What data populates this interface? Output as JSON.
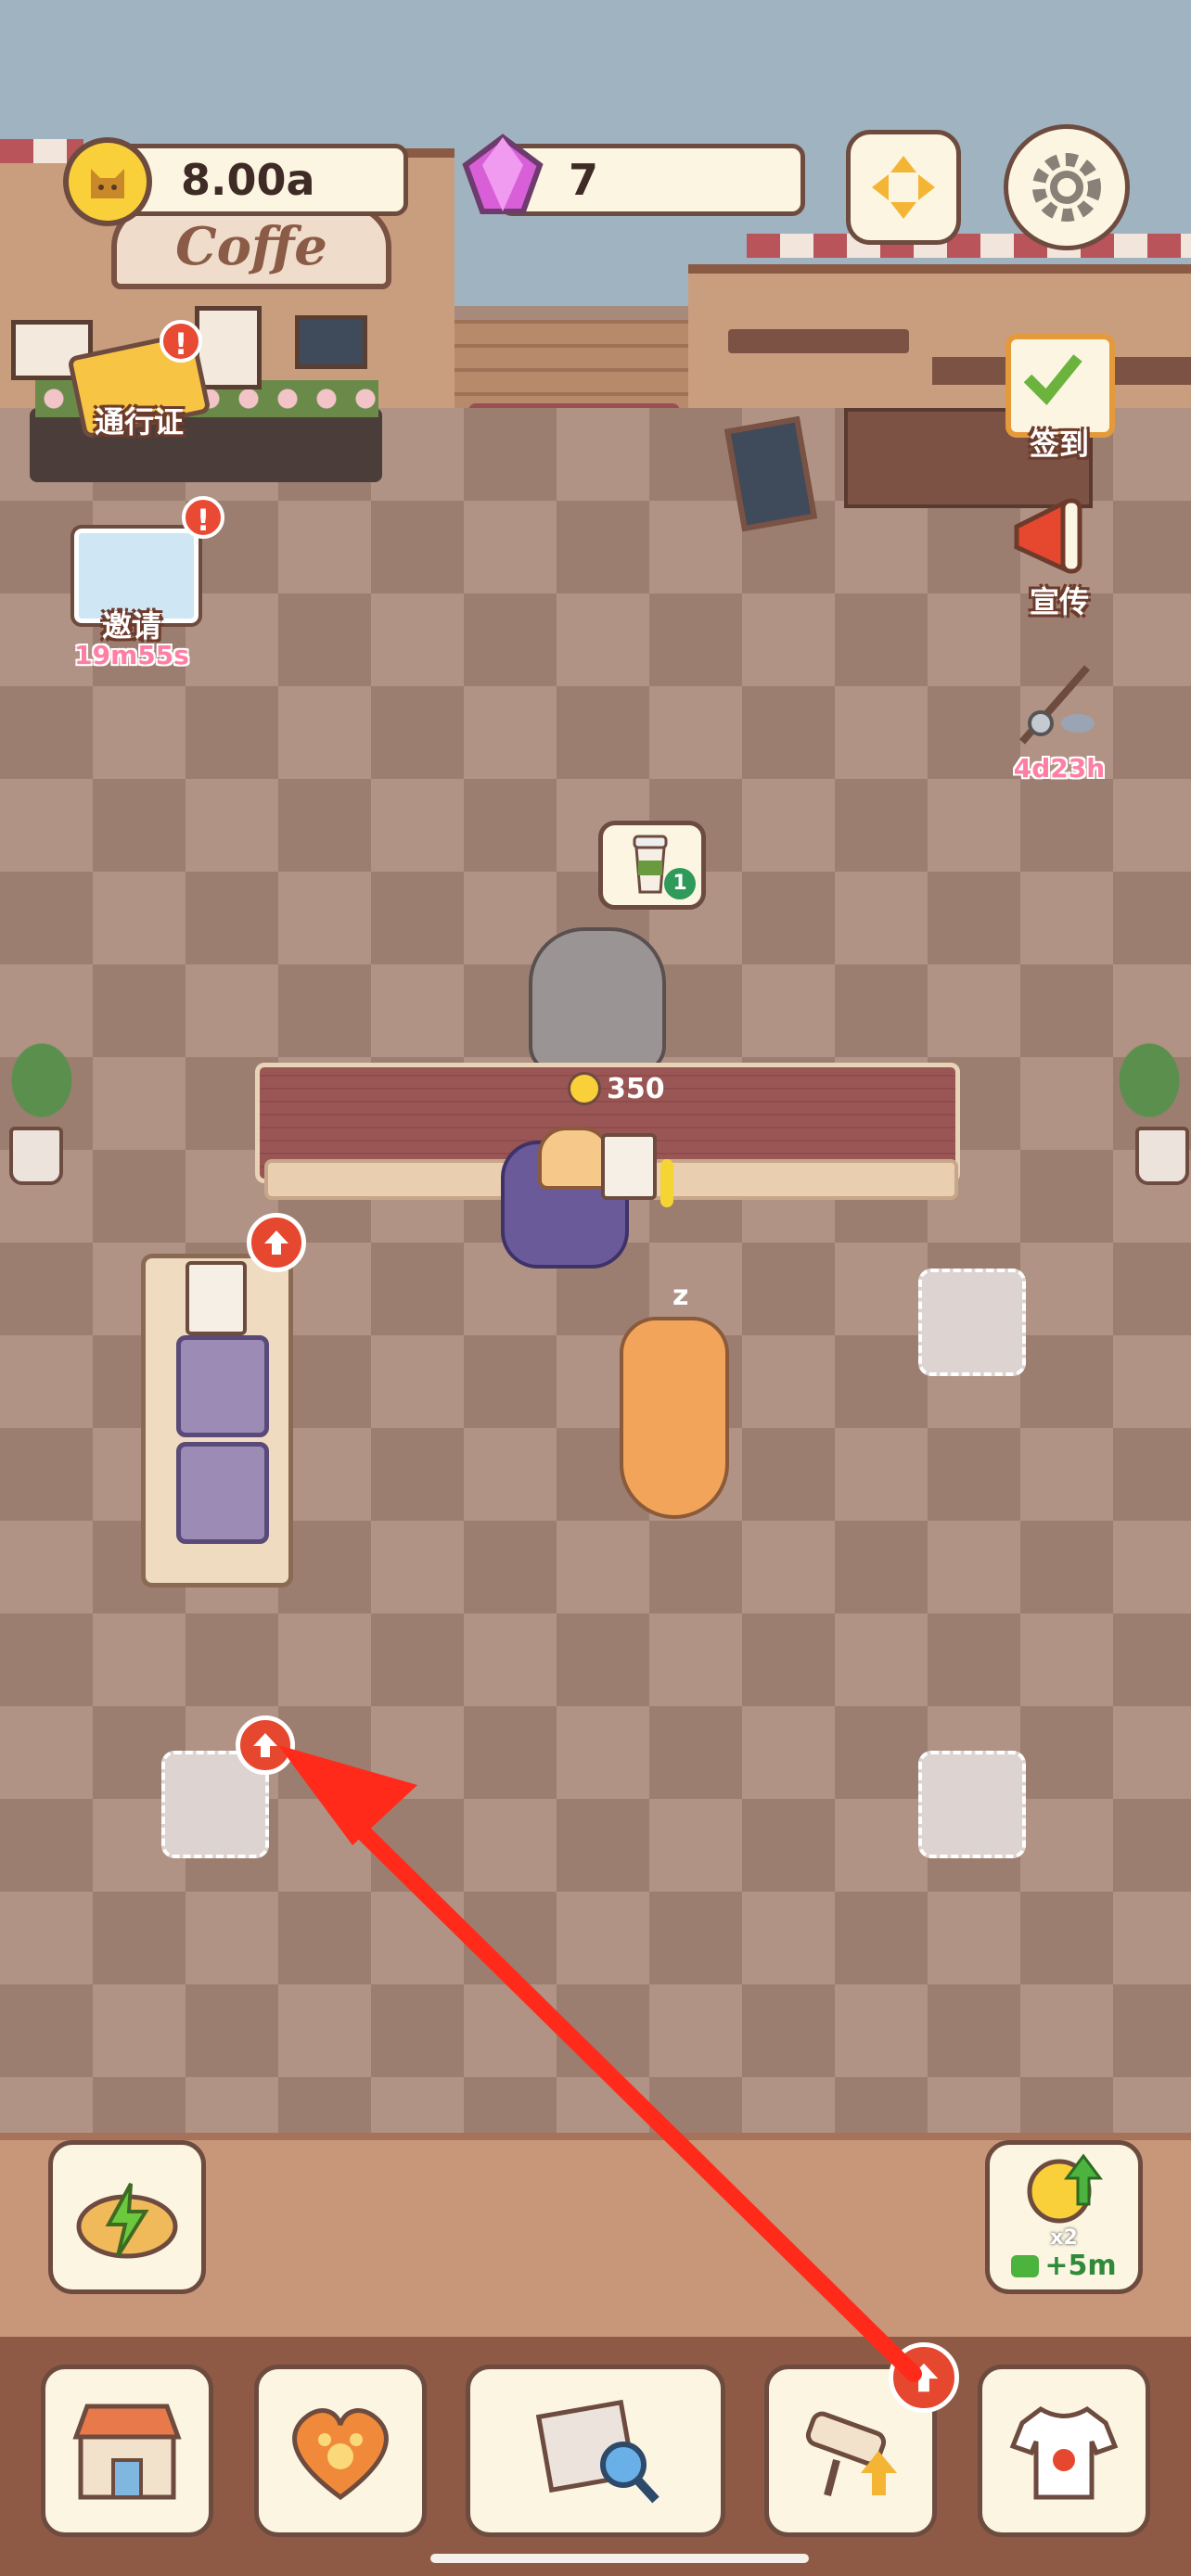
{
  "hud": {
    "coins": "8.00a",
    "gems": "7"
  },
  "sign": {
    "cafe_name": "Coffe"
  },
  "left_side": {
    "pass_label": "通行证",
    "invite_label": "邀请",
    "invite_timer": "19m55s",
    "badge": "!"
  },
  "right_side": {
    "checkin_label": "签到",
    "promo_label": "宣传",
    "fishing_timer": "4d23h"
  },
  "order": {
    "count": "1"
  },
  "counter": {
    "price": "350"
  },
  "boost": {
    "multiplier": "x2",
    "ad_time": "+5m"
  },
  "colors": {
    "accent": "#e5472f",
    "timer": "#ff7ea3",
    "frame": "#6d4b3f"
  }
}
